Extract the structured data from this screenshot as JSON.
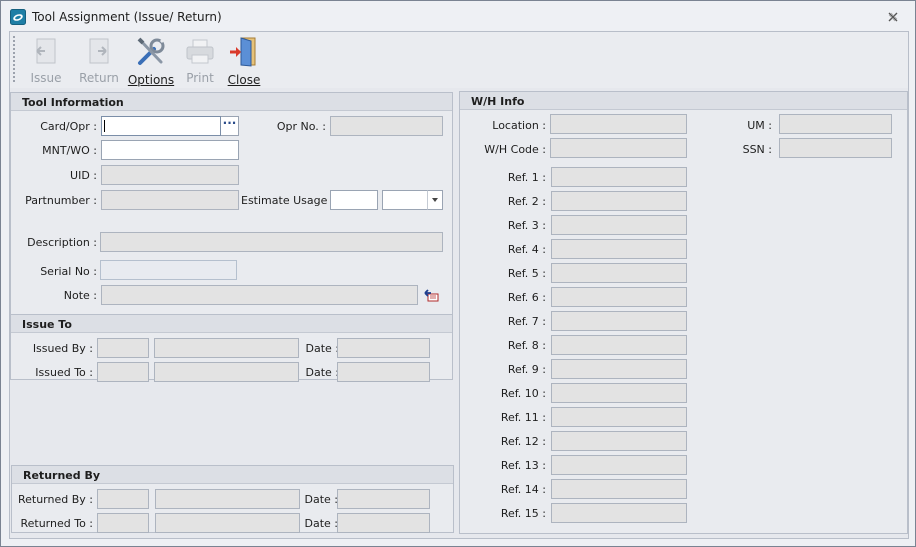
{
  "window": {
    "title": "Tool Assignment (Issue/ Return)"
  },
  "toolbar": {
    "issue_label": "Issue",
    "return_label": "Return",
    "options_label": "Options",
    "print_label": "Print",
    "close_label": "Close"
  },
  "tool_info": {
    "header": "Tool Information",
    "card_opr_label": "Card/Opr :",
    "card_opr_value": "",
    "ellipsis_label": "···",
    "opr_no_label": "Opr No. :",
    "opr_no_value": "",
    "mnt_wo_label": "MNT/WO :",
    "mnt_wo_value": "",
    "uid_label": "UID :",
    "uid_value": "",
    "partnumber_label": "Partnumber :",
    "partnumber_value": "",
    "estimate_usage_label": "Estimate Usage :",
    "estimate_usage_value": "",
    "estimate_unit_value": "",
    "description_label": "Description :",
    "description_value": "",
    "serial_no_label": "Serial No :",
    "serial_no_value": "",
    "note_label": "Note :",
    "note_value": ""
  },
  "issue_to": {
    "header": "Issue To",
    "issued_by_label": "Issued By :",
    "issued_to_label": "Issued To :",
    "date_label": "Date :"
  },
  "returned_by": {
    "header": "Returned By",
    "returned_by_label": "Returned By :",
    "returned_to_label": "Returned To :",
    "date_label": "Date :"
  },
  "wh_info": {
    "header": "W/H Info",
    "location_label": "Location :",
    "wh_code_label": "W/H Code :",
    "um_label": "UM :",
    "ssn_label": "SSN :",
    "refs": [
      "Ref. 1 :",
      "Ref. 2 :",
      "Ref. 3 :",
      "Ref. 4 :",
      "Ref. 5 :",
      "Ref. 6 :",
      "Ref. 7 :",
      "Ref. 8 :",
      "Ref. 9 :",
      "Ref. 10 :",
      "Ref. 11 :",
      "Ref. 12 :",
      "Ref. 13 :",
      "Ref. 14 :",
      "Ref. 15 :"
    ]
  }
}
